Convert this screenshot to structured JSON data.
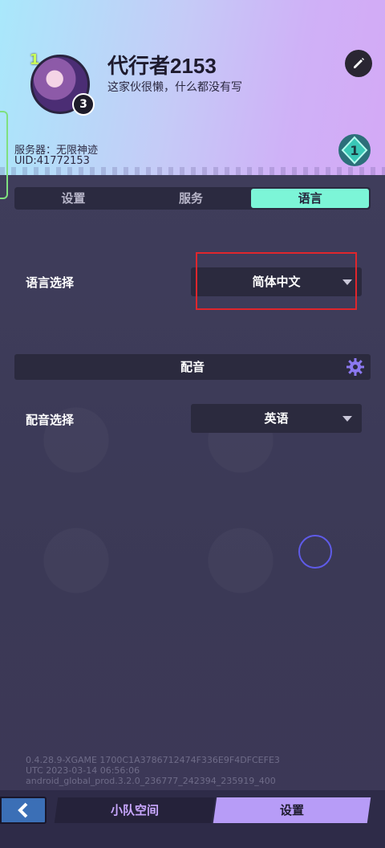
{
  "profile": {
    "name": "代行者2153",
    "bio": "这家伙很懒，什么都没有写",
    "level": "1",
    "rank_badge": "3",
    "server": "服务器：无限神迹",
    "uid": "UID:41772153"
  },
  "tabs": [
    {
      "label": "设置",
      "active": false
    },
    {
      "label": "服务",
      "active": false
    },
    {
      "label": "语言",
      "active": true
    }
  ],
  "language": {
    "label": "语言选择",
    "value": "简体中文"
  },
  "voice_section": {
    "title": "配音"
  },
  "voice": {
    "label": "配音选择",
    "value": "英语"
  },
  "version_lines": [
    "0.4.28.9-XGAME 1700C1A3786712474F336E9F4DFCEFE3",
    "UTC 2023-03-14 06:56:06",
    "android_global_prod.3.2.0_236777_242394_235919_400"
  ],
  "bottom_nav": {
    "back_icon": "chevron-left-icon",
    "team_label": "小队空间",
    "settings_label": "设置"
  },
  "colors": {
    "accent_tab": "#7cf5d7",
    "nav_active": "#b79cf7",
    "highlight_box": "#e0262c"
  }
}
